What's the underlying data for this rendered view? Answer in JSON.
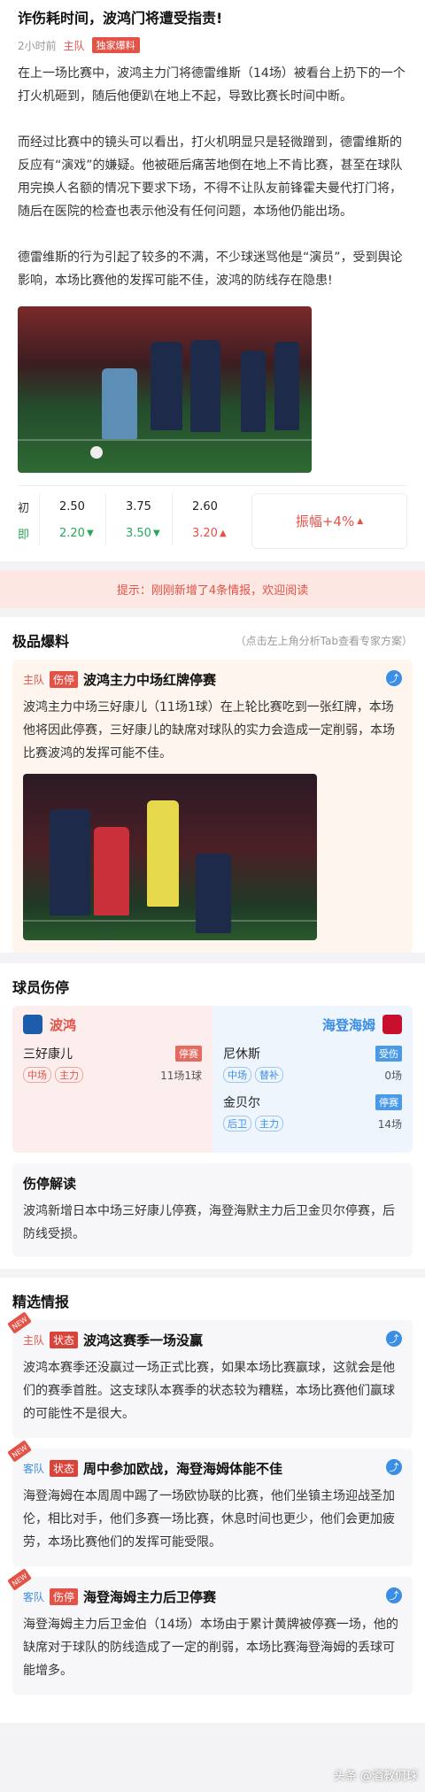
{
  "article": {
    "title": "诈伤耗时间，波鸿门将遭受指责!",
    "time": "2小时前",
    "side": "主队",
    "badge": "独家爆料",
    "paragraphs": [
      "在上一场比赛中，波鸿主力门将德雷维斯（14场）被看台上扔下的一个打火机砸到，随后他便趴在地上不起，导致比赛长时间中断。",
      "而经过比赛中的镜头可以看出，打火机明显只是轻微蹭到，德雷维斯的反应有“演戏”的嫌疑。他被砸后痛苦地倒在地上不肯比赛，甚至在球队用完换人名额的情况下要求下场，不得不让队友前锋霍夫曼代打门将，随后在医院的检查也表示他没有任何问题，本场他仍能出场。",
      "德雷维斯的行为引起了较多的不满，不少球迷骂他是“演员”，受到舆论影响，本场比赛他的发挥可能不佳，波鸿的防线存在隐患!"
    ]
  },
  "odds": {
    "initial_label": "初",
    "current_label": "即",
    "initial": [
      "2.50",
      "3.75",
      "2.60"
    ],
    "current": [
      "2.20",
      "3.50",
      "3.20"
    ],
    "amplitude": "振幅+4%"
  },
  "tip": "提示：刚刚新增了4条情报，欢迎阅读",
  "premium": {
    "title": "极品爆料",
    "note": "（点击左上角分析Tab查看专家方案）",
    "item": {
      "side": "主队",
      "kind": "伤停",
      "title": "波鸿主力中场红牌停赛",
      "text": "波鸿主力中场三好康儿（11场1球）在上轮比赛吃到一张红牌，本场他将因此停赛，三好康儿的缺席对球队的实力会造成一定削弱，本场比赛波鸿的发挥可能不佳。"
    }
  },
  "injuries": {
    "title": "球员伤停",
    "home": {
      "team": "波鸿",
      "players": [
        {
          "name": "三好康儿",
          "status": "停赛",
          "positions": [
            "中场",
            "主力"
          ],
          "apps": "11场1球"
        }
      ]
    },
    "away": {
      "team": "海登海姆",
      "players": [
        {
          "name": "尼休斯",
          "status": "受伤",
          "positions": [
            "中场",
            "替补"
          ],
          "apps": "0场"
        },
        {
          "name": "金贝尔",
          "status": "停赛",
          "positions": [
            "后卫",
            "主力"
          ],
          "apps": "14场"
        }
      ]
    },
    "analysis_title": "伤停解读",
    "analysis_text": "波鸿新增日本中场三好康儿停赛，海登海默主力后卫金贝尔停赛，后防线受损。"
  },
  "selected": {
    "title": "精选情报",
    "items": [
      {
        "side": "主队",
        "kind": "状态",
        "title": "波鸿这赛季一场没赢",
        "text": "波鸿本赛季还没赢过一场正式比赛，如果本场比赛赢球，这就会是他们的赛季首胜。这支球队本赛季的状态较为糟糕，本场比赛他们赢球的可能性不是很大。"
      },
      {
        "side": "客队",
        "kind": "状态",
        "title": "周中参加欧战，海登海姆体能不佳",
        "text": "海登海姆在本周周中踢了一场欧协联的比赛，他们坐镇主场迎战圣加伦，相比对手，他们多赛一场比赛，休息时间也更少，他们会更加疲劳，本场比赛他们的发挥可能受限。"
      },
      {
        "side": "客队",
        "kind": "伤停",
        "title": "海登海姆主力后卫停赛",
        "text": "海登海姆主力后卫金伯（14场）本场由于累计黄牌被停赛一场，他的缺席对于球队的防线造成了一定的削弱，本场比赛海登海姆的丢球可能增多。"
      }
    ]
  },
  "new_label": "NEW",
  "watermark": "头条 @酒教侃球",
  "colors": {
    "accent_red": "#e35247",
    "accent_blue": "#3a8ee6",
    "up_green": "#2aa55a"
  }
}
